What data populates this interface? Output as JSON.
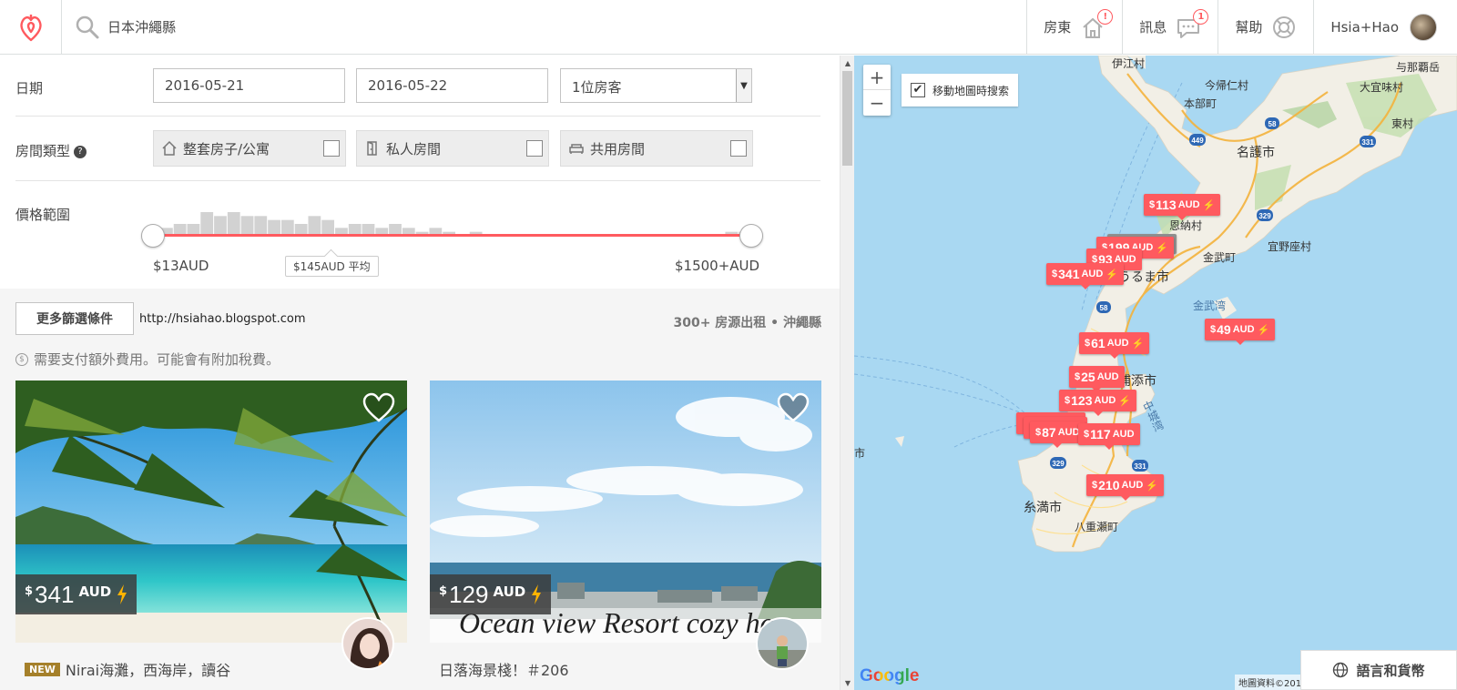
{
  "header": {
    "search_text": "日本沖繩縣",
    "nav": {
      "host_label": "房東",
      "host_badge": "!",
      "messages_label": "訊息",
      "messages_badge": "1",
      "help_label": "幫助",
      "user_name": "Hsia+Hao"
    }
  },
  "filters": {
    "date_label": "日期",
    "checkin": "2016-05-21",
    "checkout": "2016-05-22",
    "guests": "1位房客",
    "room_type_label": "房間類型",
    "room_types": [
      {
        "label": "整套房子/公寓",
        "checked": false
      },
      {
        "label": "私人房間",
        "checked": false
      },
      {
        "label": "共用房間",
        "checked": false
      }
    ],
    "price_range_label": "價格範圍",
    "price_min": "$13AUD",
    "price_max": "$1500+AUD",
    "price_avg": "$145AUD 平均",
    "histogram": [
      2,
      3,
      3,
      6,
      5,
      6,
      5,
      5,
      4,
      4,
      3,
      5,
      4,
      2,
      3,
      3,
      2,
      3,
      2,
      1,
      2,
      1,
      0,
      1,
      0,
      0,
      0,
      0,
      0,
      0,
      0,
      0,
      0,
      0,
      0,
      0,
      0,
      0,
      0,
      0,
      0,
      0,
      1,
      1
    ]
  },
  "results": {
    "more_filters": "更多篩選條件",
    "blog_url": "http://hsiahao.blogspot.com",
    "count_text": "300+ 房源出租 • 沖繩縣",
    "fee_note": "需要支付額外費用。可能會有附加稅費。",
    "listings": [
      {
        "price_symbol": "$",
        "price": "341",
        "currency": "AUD",
        "new_tag": "NEW",
        "title": "Nirai海灘，西海岸，讀谷"
      },
      {
        "price_symbol": "$",
        "price": "129",
        "currency": "AUD",
        "new_tag": "",
        "title": "日落海景棧！＃206",
        "overlay_text": "Ocean view Resort cozy ho"
      }
    ]
  },
  "map": {
    "search_when_move": "移動地圖時搜索",
    "search_when_move_checked": true,
    "markers": [
      {
        "symbol": "$",
        "price": "113",
        "currency": "AUD"
      },
      {
        "symbol": "$",
        "price": "199",
        "currency": "AUD"
      },
      {
        "symbol": "$",
        "price": "93",
        "currency": "AUD"
      },
      {
        "symbol": "$",
        "price": "341",
        "currency": "AUD"
      },
      {
        "symbol": "$",
        "price": "49",
        "currency": "AUD"
      },
      {
        "symbol": "$",
        "price": "61",
        "currency": "AUD"
      },
      {
        "symbol": "$",
        "price": "25",
        "currency": "AUD"
      },
      {
        "symbol": "$",
        "price": "123",
        "currency": "AUD"
      },
      {
        "symbol": "$",
        "price": "87",
        "currency": "AUD"
      },
      {
        "symbol": "$",
        "price": "117",
        "currency": "AUD"
      },
      {
        "symbol": "$",
        "price": "210",
        "currency": "AUD"
      }
    ],
    "places": [
      "伊江村",
      "今帰仁村",
      "本部町",
      "名護市",
      "大宜味村",
      "東村",
      "与那覇岳",
      "恩納村",
      "金武町",
      "宜野座村",
      "うるま市",
      "金武湾",
      "糸満市",
      "八重瀬町",
      "中城湾",
      "浦添市",
      "市"
    ],
    "routes": [
      "449",
      "58",
      "331",
      "329",
      "58",
      "329",
      "331"
    ],
    "google": "Google",
    "attribution": "地圖資料©2016",
    "lang_button": "語言和貨幣"
  },
  "colors": {
    "brand": "#ff5a5f",
    "water": "#a9d8f2",
    "land": "#f2efe6"
  }
}
